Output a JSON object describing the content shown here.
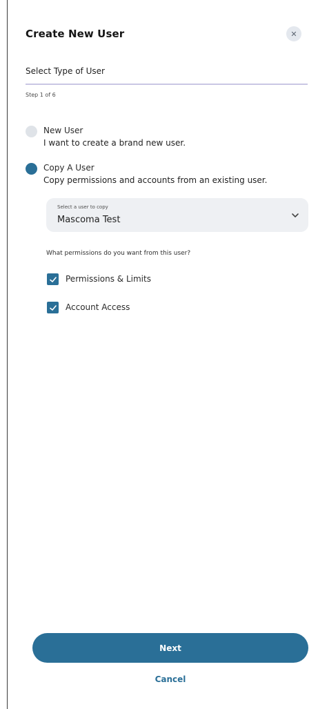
{
  "dialog": {
    "title": "Create New User",
    "close_icon": "close-icon"
  },
  "step": {
    "title": "Select Type of User",
    "counter": "Step 1 of 6"
  },
  "user_types": [
    {
      "label": "New User",
      "description": "I want to create a brand new user.",
      "selected": false
    },
    {
      "label": "Copy A User",
      "description": "Copy permissions and accounts from an existing user.",
      "selected": true
    }
  ],
  "copy_select": {
    "caption": "Select a user to copy",
    "value": "Mascoma Test",
    "icon": "chevron-down-icon"
  },
  "permissions": {
    "question": "What permissions do you want from this user?",
    "options": [
      {
        "label": "Permissions & Limits",
        "checked": true
      },
      {
        "label": "Account Access",
        "checked": true
      }
    ]
  },
  "actions": {
    "next_label": "Next",
    "cancel_label": "Cancel"
  },
  "colors": {
    "accent": "#2a6f97",
    "radio_off": "#dfe3e8",
    "step_rule": "#c9c6e4",
    "select_bg": "#eef0f3"
  }
}
